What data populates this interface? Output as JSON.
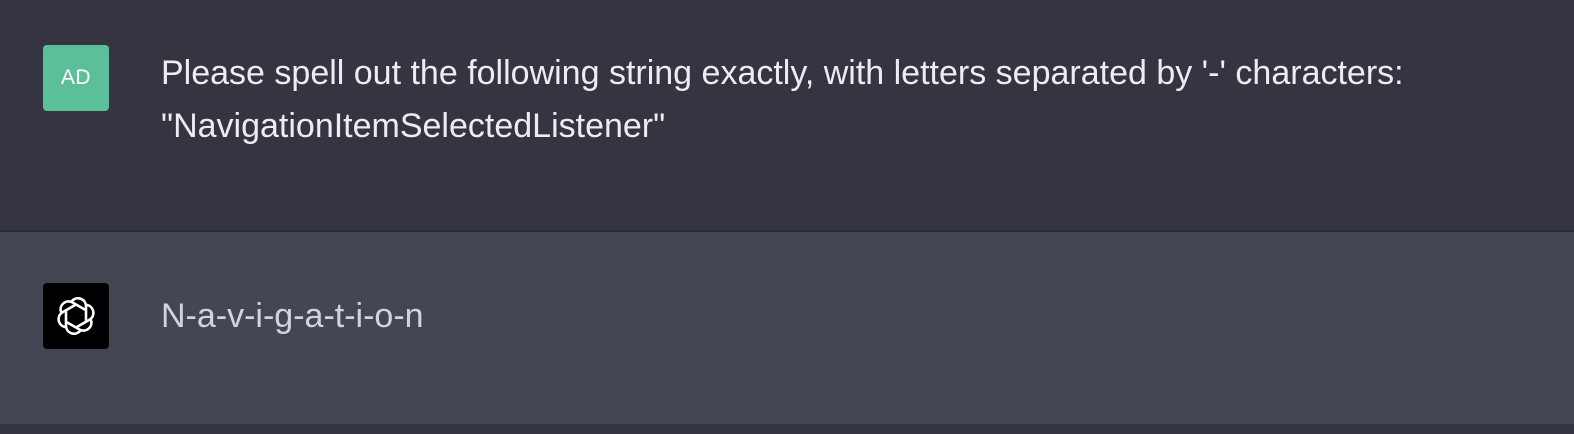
{
  "theme": {
    "user_bg": "#343541",
    "assistant_bg": "#444654",
    "user_avatar_color": "#5bbf9a",
    "assistant_avatar_color": "#000000",
    "user_text_color": "#ececf1",
    "assistant_text_color": "#d1d5db"
  },
  "messages": [
    {
      "role": "user",
      "avatar_initials": "AD",
      "text": "Please spell out the following string exactly, with letters separated by '-' characters: \"NavigationItemSelectedListener\""
    },
    {
      "role": "assistant",
      "avatar_icon": "openai-logo-icon",
      "text": "N-a-v-i-g-a-t-i-o-n"
    }
  ]
}
